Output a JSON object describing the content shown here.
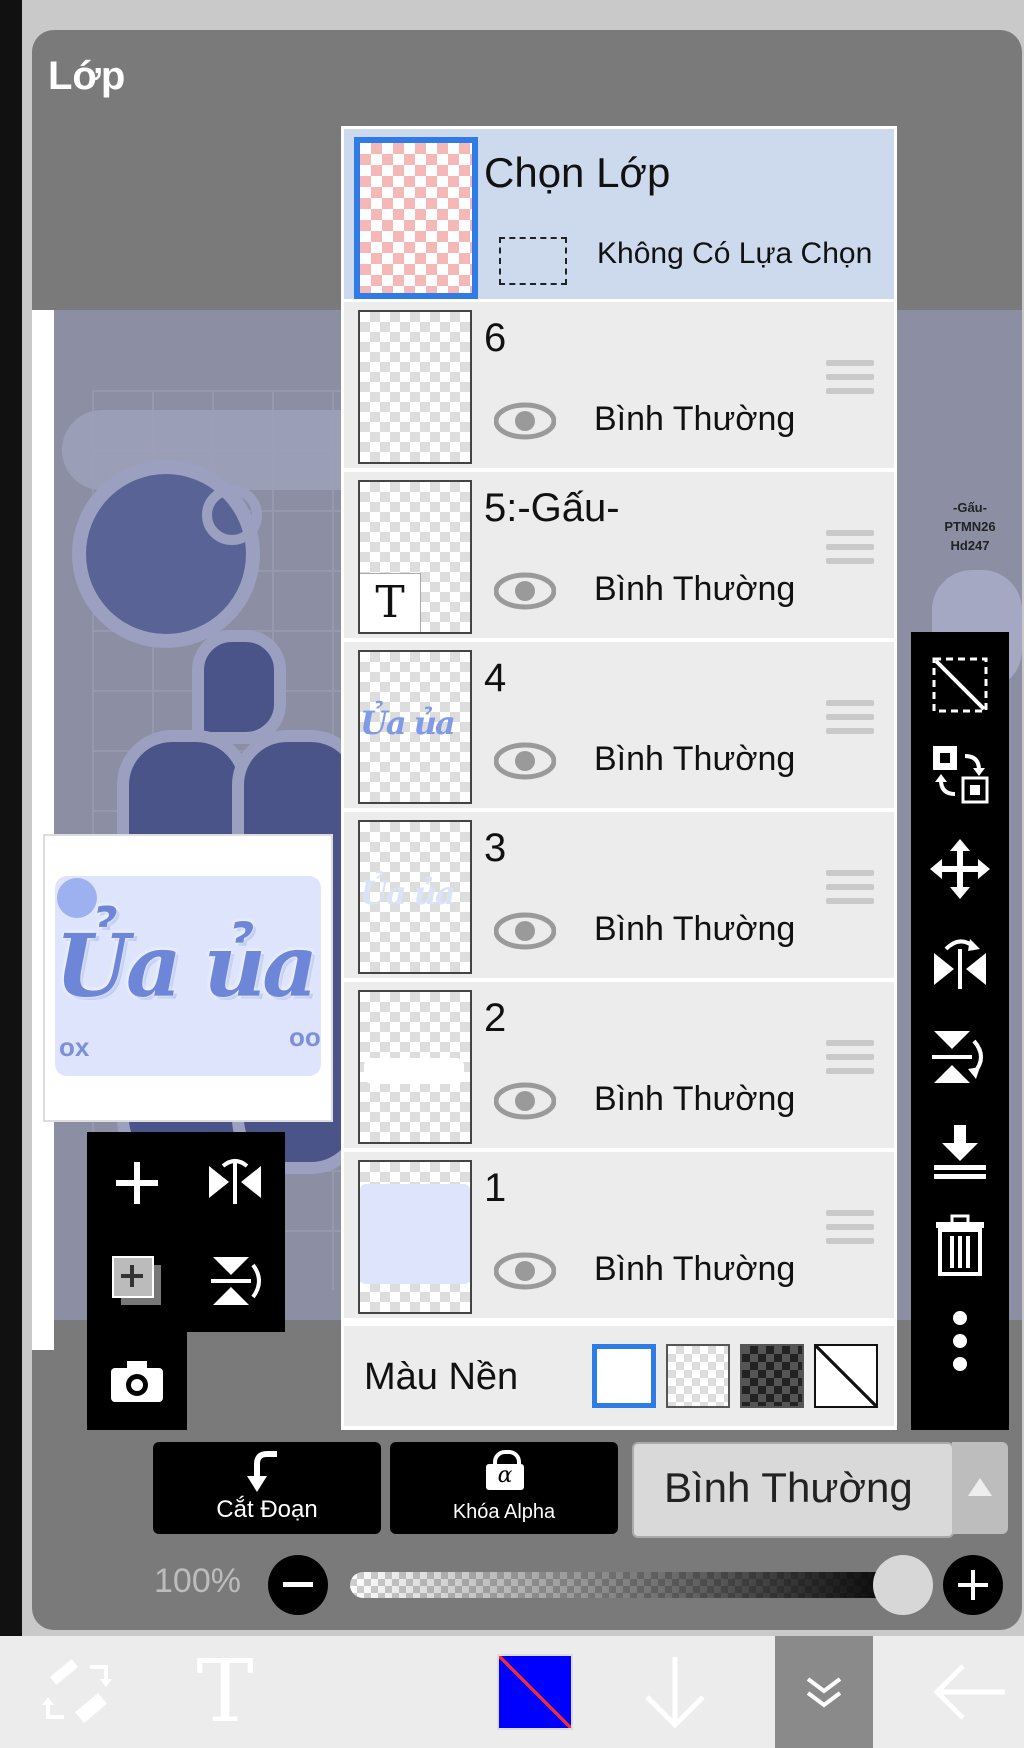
{
  "panel": {
    "title": "Lớp"
  },
  "watermark": {
    "lines": [
      "-Gấu-",
      "PTMN26",
      "Hd247"
    ]
  },
  "preview": {
    "art_text": "Ủa ủa",
    "ox": "ox",
    "oo": "oo"
  },
  "selection": {
    "title": "Chọn Lớp",
    "subtitle": "Không Có Lựa Chọn"
  },
  "layers": [
    {
      "name": "6",
      "mode": "Bình Thường"
    },
    {
      "name": "5:-Gấu-",
      "mode": "Bình Thường",
      "text_marker": "T"
    },
    {
      "name": "4",
      "mode": "Bình Thường",
      "thumb_text": "Ủa ủa"
    },
    {
      "name": "3",
      "mode": "Bình Thường",
      "thumb_text": "Ủa ủa"
    },
    {
      "name": "2",
      "mode": "Bình Thường"
    },
    {
      "name": "1",
      "mode": "Bình Thường"
    }
  ],
  "background": {
    "label": "Màu Nền",
    "options": [
      "white",
      "transparent",
      "dark-checker",
      "none"
    ],
    "selected": "white"
  },
  "bottom": {
    "clip_label": "Cắt Đoạn",
    "alpha_lock_label": "Khóa Alpha",
    "alpha_glyph": "α",
    "blend_mode": "Bình Thường",
    "opacity": "100%",
    "opacity_value": 1.0
  },
  "nav": {
    "text_tool": "T",
    "primary_color": "#0000ff"
  },
  "colors": {
    "accent": "#2f7ce8",
    "selected_row": "#cdd9ec",
    "panel": "#7a7a7a"
  }
}
